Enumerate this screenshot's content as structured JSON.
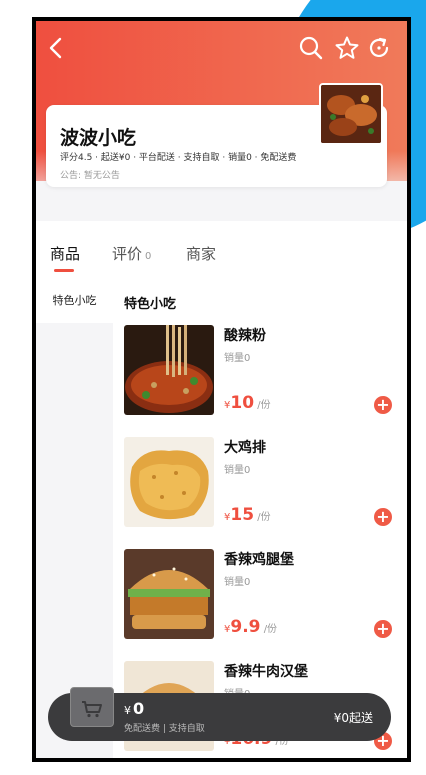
{
  "colors": {
    "accent": "#ef4f3f",
    "cart_bg": "#3b3b3d"
  },
  "topbar": {
    "icons": [
      "back-arrow-icon",
      "search-icon",
      "star-icon",
      "share-icon"
    ]
  },
  "store": {
    "name": "波波小吃",
    "meta": "评分4.5 · 起送¥0 · 平台配送 · 支持自取 · 销量0 · 免配送费",
    "notice": "公告: 暂无公告"
  },
  "tabs": [
    {
      "label": "商品"
    },
    {
      "label": "评价",
      "count": "0"
    },
    {
      "label": "商家"
    }
  ],
  "sidebar": {
    "items": [
      {
        "label": "特色小吃"
      }
    ]
  },
  "category": {
    "title": "特色小吃"
  },
  "items": [
    {
      "name": "酸辣粉",
      "sales": "销量0",
      "currency": "¥",
      "price": "10",
      "unit": "/份"
    },
    {
      "name": "大鸡排",
      "sales": "销量0",
      "currency": "¥",
      "price": "15",
      "unit": "/份"
    },
    {
      "name": "香辣鸡腿堡",
      "sales": "销量0",
      "currency": "¥",
      "price": "9.9",
      "unit": "/份"
    },
    {
      "name": "香辣牛肉汉堡",
      "sales": "销量0",
      "currency": "¥",
      "price": "16.9",
      "unit": "/份"
    }
  ],
  "cart": {
    "currency": "¥",
    "total": "0",
    "sub": "免配送费 | 支持自取",
    "min_order": "¥0起送"
  }
}
